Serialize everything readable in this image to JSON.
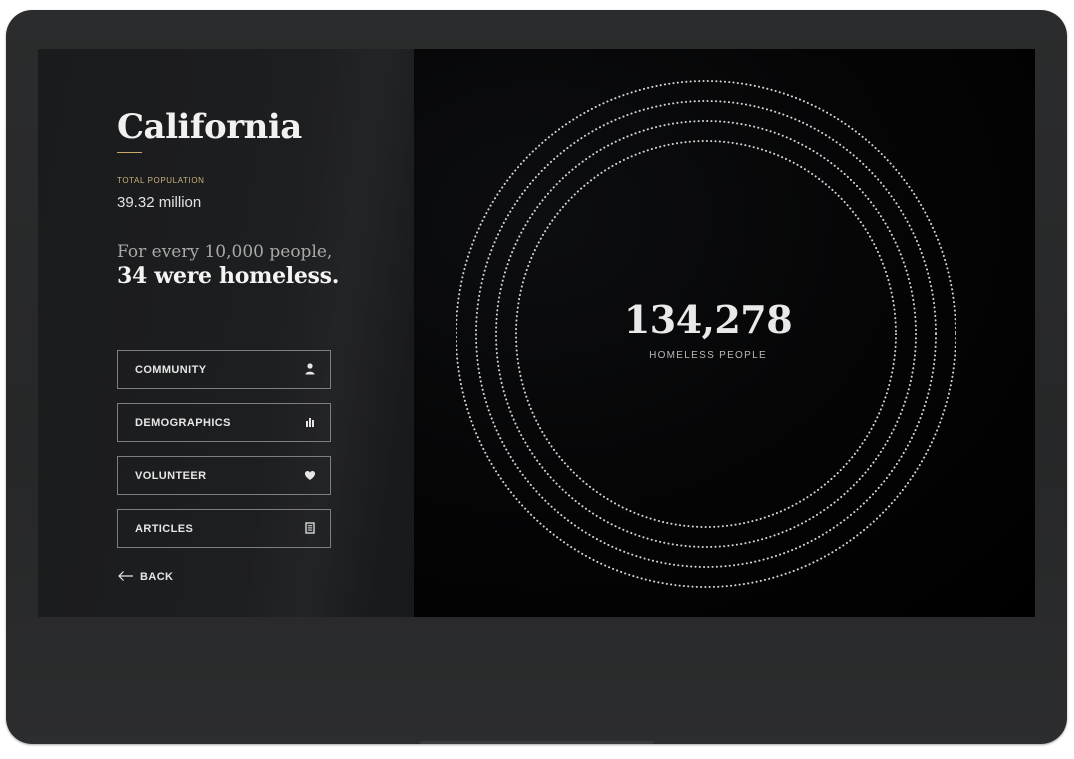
{
  "state": {
    "name": "California",
    "population_label": "TOTAL POPULATION",
    "population_value": "39.32 million",
    "rate_line1": "For every 10,000 people,",
    "rate_line2": "34 were homeless."
  },
  "menu": {
    "items": [
      {
        "label": "COMMUNITY",
        "icon": "person-icon"
      },
      {
        "label": "DEMOGRAPHICS",
        "icon": "bar-chart-icon"
      },
      {
        "label": "VOLUNTEER",
        "icon": "heart-icon"
      },
      {
        "label": "ARTICLES",
        "icon": "document-icon"
      }
    ]
  },
  "back": {
    "label": "BACK"
  },
  "homeless": {
    "count": "134,278",
    "label": "HOMELESS PEOPLE"
  },
  "colors": {
    "accent": "#c8a96a",
    "background": "#000000",
    "panel": "#1c1d1f",
    "text": "#f1f1f1"
  }
}
